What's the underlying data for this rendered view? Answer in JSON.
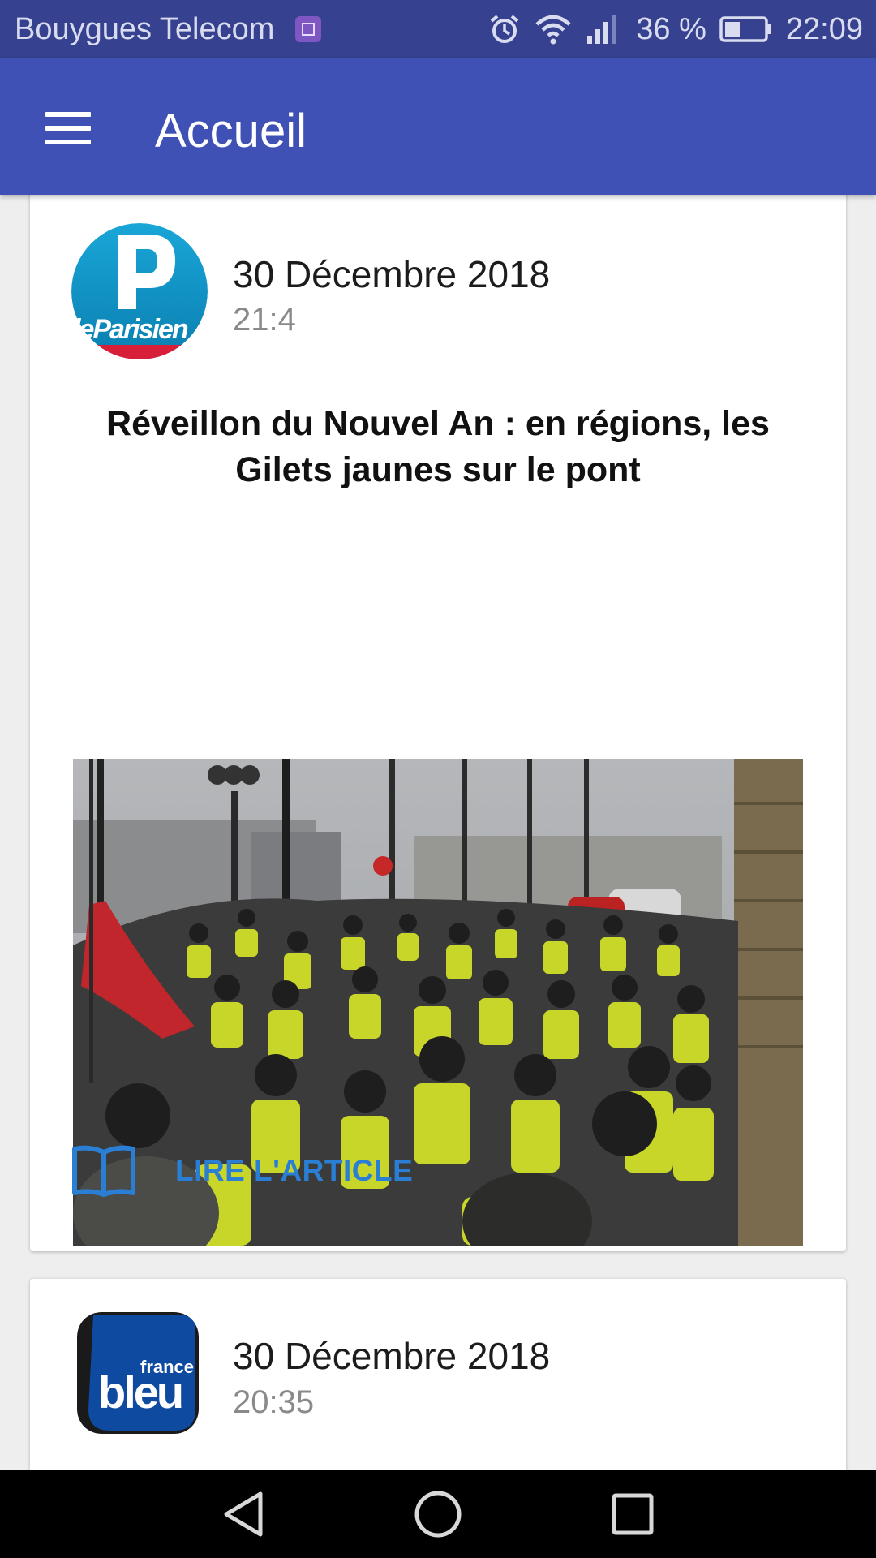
{
  "status_bar": {
    "carrier": "Bouygues Telecom",
    "battery_percent": "36 %",
    "time": "22:09",
    "icons": [
      "gallery-icon",
      "alarm-icon",
      "wifi-icon",
      "signal-icon",
      "battery-icon"
    ]
  },
  "app_bar": {
    "title": "Accueil",
    "menu_icon": "menu-icon",
    "color": "#3f51b5"
  },
  "feed": [
    {
      "source_logo": "leparisien-logo",
      "logo_text": "leParisien.fr",
      "date": "30 Décembre 2018",
      "time": "21:4",
      "headline": "Réveillon du Nouvel An : en régions, les Gilets jaunes sur le pont",
      "image": "protest-photo",
      "action_label": "LIRE L'ARTICLE",
      "action_icon": "book-icon"
    },
    {
      "source_logo": "francebleu-logo",
      "logo_text": "france bleu",
      "date": "30 Décembre 2018",
      "time": "20:35"
    }
  ],
  "nav_bar": {
    "icons": [
      "back-icon",
      "home-icon",
      "recents-icon"
    ]
  },
  "colors": {
    "status_bar": "#36418f",
    "accent_link": "#2a7fd4",
    "background": "#eeeeee"
  }
}
